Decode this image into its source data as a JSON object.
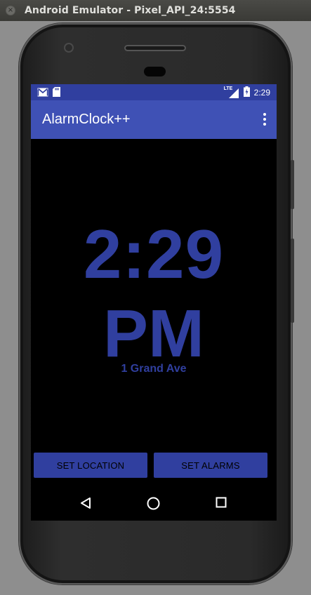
{
  "window": {
    "title": "Android Emulator - Pixel_API_24:5554",
    "close_glyph": "×"
  },
  "statusbar": {
    "network": "LTE",
    "time": "2:29",
    "icons": [
      "gmail-notification-icon",
      "sd-card-icon",
      "lte-signal-icon",
      "battery-icon"
    ]
  },
  "app": {
    "title": "AlarmClock++",
    "menu_icon": "overflow-menu-icon"
  },
  "clock": {
    "time": "2:29",
    "ampm": "PM",
    "location": "1 Grand Ave"
  },
  "buttons": {
    "set_location": "SET LOCATION",
    "set_alarms": "SET ALARMS"
  },
  "navbar": {
    "icons": [
      "back-icon",
      "home-icon",
      "recents-icon"
    ]
  },
  "colors": {
    "status_bar": "#303f9f",
    "app_bar": "#3f51b5",
    "accent_text": "#303f9f",
    "screen_bg": "#000000"
  }
}
